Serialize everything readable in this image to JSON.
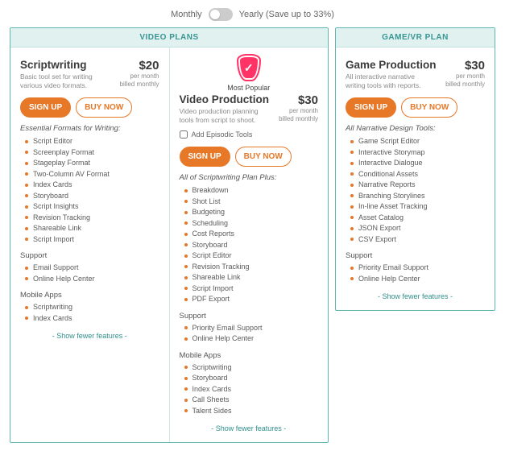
{
  "billing_toggle": {
    "monthly_label": "Monthly",
    "yearly_label": "Yearly (Save up to 33%)"
  },
  "groups": {
    "video": {
      "header": "VIDEO PLANS"
    },
    "game": {
      "header": "GAME/VR PLAN"
    }
  },
  "popular_badge": "Most Popular",
  "buttons": {
    "signup": "SIGN UP",
    "buynow": "BUY NOW",
    "show_fewer": "- Show fewer features -"
  },
  "plans": {
    "scriptwriting": {
      "title": "Scriptwriting",
      "subtitle": "Basic tool set for writing various video formats.",
      "price": "$20",
      "price_note1": "per month",
      "price_note2": "billed monthly",
      "features_title": "Essential Formats for Writing:",
      "features": [
        "Script Editor",
        "Screenplay Format",
        "Stageplay Format",
        "Two-Column AV Format",
        "Index Cards",
        "Storyboard",
        "Script Insights",
        "Revision Tracking",
        "Shareable Link",
        "Script Import"
      ],
      "support_label": "Support",
      "support": [
        "Email Support",
        "Online Help Center"
      ],
      "mobile_label": "Mobile Apps",
      "mobile": [
        "Scriptwriting",
        "Index Cards"
      ]
    },
    "video_production": {
      "title": "Video Production",
      "subtitle": "Video production planning tools from script to shoot.",
      "price": "$30",
      "price_note1": "per month",
      "price_note2": "billed monthly",
      "episodic_label": "Add Episodic Tools",
      "features_title": "All of Scriptwriting Plan Plus:",
      "features": [
        "Breakdown",
        "Shot List",
        "Budgeting",
        "Scheduling",
        "Cost Reports",
        "Storyboard",
        "Script Editor",
        "Revision Tracking",
        "Shareable Link",
        "Script Import",
        "PDF Export"
      ],
      "support_label": "Support",
      "support": [
        "Priority Email Support",
        "Online Help Center"
      ],
      "mobile_label": "Mobile Apps",
      "mobile": [
        "Scriptwriting",
        "Storyboard",
        "Index Cards",
        "Call Sheets",
        "Talent Sides"
      ]
    },
    "game_production": {
      "title": "Game Production",
      "subtitle": "All interactive narrative writing tools with reports.",
      "price": "$30",
      "price_note1": "per month",
      "price_note2": "billed monthly",
      "features_title": "All Narrative Design Tools:",
      "features": [
        "Game Script Editor",
        "Interactive Storymap",
        "Interactive Dialogue",
        "Conditional Assets",
        "Narrative Reports",
        "Branching Storylines",
        "In-line Asset Tracking",
        "Asset Catalog",
        "JSON Export",
        "CSV Export"
      ],
      "support_label": "Support",
      "support": [
        "Priority Email Support",
        "Online Help Center"
      ]
    }
  }
}
